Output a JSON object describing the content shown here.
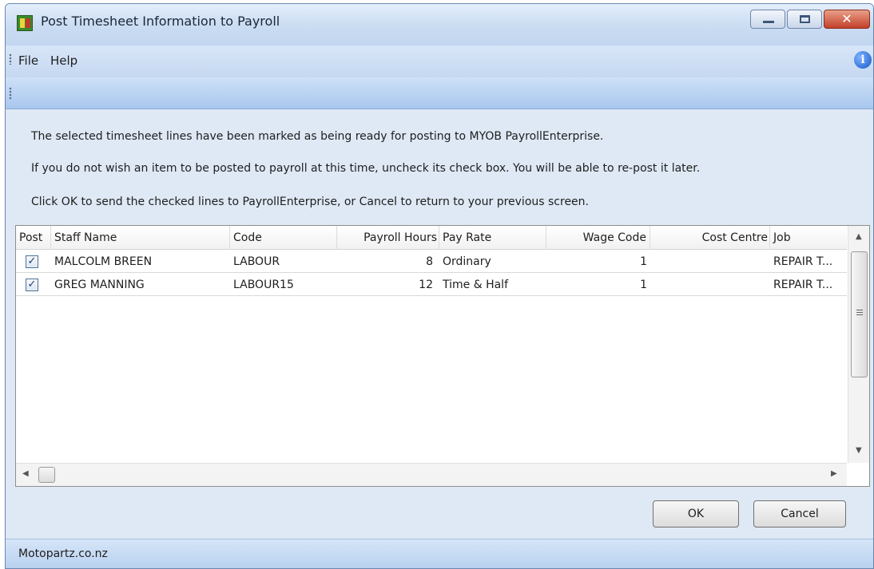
{
  "window": {
    "title": "Post Timesheet Information to Payroll"
  },
  "titlebar_buttons": {
    "close_glyph": "✕"
  },
  "menu": {
    "file": "File",
    "help": "Help",
    "info_glyph": "i"
  },
  "message": {
    "line1": "The selected timesheet lines have been marked as being ready for posting to MYOB PayrollEnterprise.",
    "line2": "If you do not wish an item to be posted to payroll at this time, uncheck its check box. You will be able to re-post it later.",
    "line3": "Click OK to send the checked lines to PayrollEnterprise, or Cancel to return to your previous screen."
  },
  "grid": {
    "columns": [
      "Post",
      "Staff Name",
      "Code",
      "Payroll Hours",
      "Pay Rate",
      "Wage Code",
      "Cost Centre",
      "Job"
    ],
    "rows": [
      {
        "post": true,
        "check": "✓",
        "staff_name": "MALCOLM BREEN",
        "code": "LABOUR",
        "payroll_hours": "8",
        "pay_rate": "Ordinary",
        "wage_code": "1",
        "cost_centre": "",
        "job": "REPAIR T..."
      },
      {
        "post": true,
        "check": "✓",
        "staff_name": "GREG MANNING",
        "code": "LABOUR15",
        "payroll_hours": "12",
        "pay_rate": "Time & Half",
        "wage_code": "1",
        "cost_centre": "",
        "job": "REPAIR T..."
      }
    ],
    "scroll_up": "▲",
    "scroll_down": "▼",
    "scroll_left": "◀",
    "scroll_right": "▶"
  },
  "buttons": {
    "ok": "OK",
    "cancel": "Cancel"
  },
  "status": {
    "text": "Motopartz.co.nz"
  },
  "colors": {
    "titlebar": "#c9dcf2",
    "toolbar": "#a9c7ee",
    "close": "#c2402a",
    "window_bg": "#dfe9f5"
  },
  "icons": [
    "app-icon",
    "minimize-icon",
    "maximize-icon",
    "close-icon",
    "info-icon",
    "checkbox-icon",
    "scroll-arrow-icon"
  ]
}
